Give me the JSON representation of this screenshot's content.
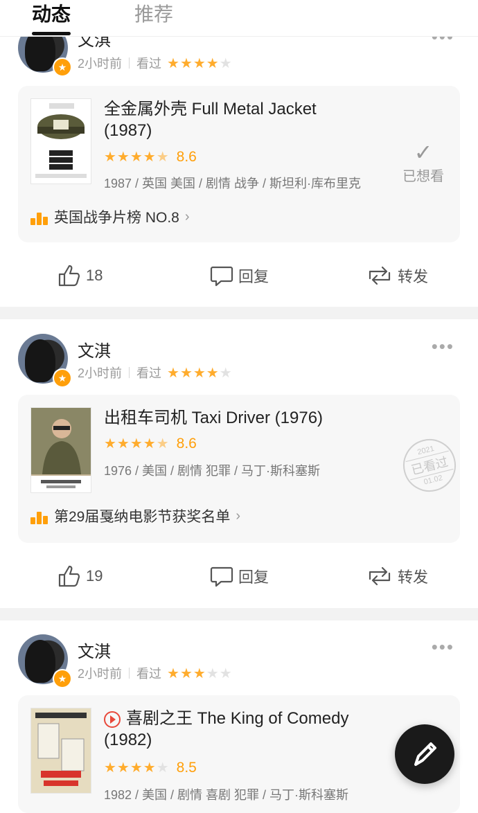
{
  "tabs": [
    {
      "label": "动态",
      "active": true
    },
    {
      "label": "推荐",
      "active": false
    }
  ],
  "posts": [
    {
      "username": "文淇",
      "time": "2小时前",
      "action": "看过",
      "user_rating": 4,
      "movie": {
        "title": "全金属外壳 Full Metal Jacket (1987)",
        "stars": 4.5,
        "score": "8.6",
        "info": "1987 / 英国 美国 / 剧情 战争 / 斯坦利·库布里克",
        "ranking": "英国战争片榜 NO.8",
        "status": "已想看",
        "poster_text": "FULL METAL JACKET"
      },
      "likes": "18",
      "reply_label": "回复",
      "share_label": "转发"
    },
    {
      "username": "文淇",
      "time": "2小时前",
      "action": "看过",
      "user_rating": 4,
      "movie": {
        "title": "出租车司机 Taxi Driver (1976)",
        "stars": 4.5,
        "score": "8.6",
        "info": "1976 / 美国 / 剧情 犯罪 / 马丁·斯科塞斯",
        "ranking": "第29届戛纳电影节获奖名单",
        "seal_year": "2021",
        "seal_text": "已看过",
        "seal_date": "01.02",
        "poster_text": "TAXI DRIVER"
      },
      "likes": "19",
      "reply_label": "回复",
      "share_label": "转发"
    },
    {
      "username": "文淇",
      "time": "2小时前",
      "action": "看过",
      "user_rating": 3,
      "movie": {
        "title": "喜剧之王 The King of Comedy (1982)",
        "stars": 4,
        "score": "8.5",
        "info": "1982 / 美国 / 剧情 喜剧 犯罪 / 马丁·斯科塞斯",
        "poster_text": "KING OF COMEDY"
      }
    }
  ],
  "colors": {
    "accent": "#ffac2d",
    "score": "#ff9f0a",
    "play": "#e8483a"
  },
  "fab_icon": "pen-icon"
}
